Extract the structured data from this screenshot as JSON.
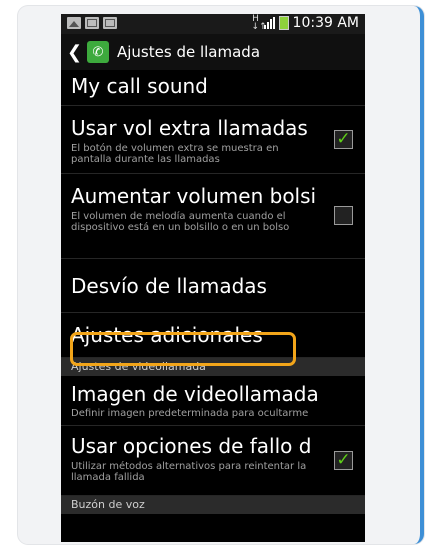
{
  "status_bar": {
    "time": "10:39 AM",
    "icons": [
      "gallery-icon",
      "mail-icon",
      "mail-icon"
    ]
  },
  "app_bar": {
    "title": "Ajustes de llamada",
    "back_icon": "back-arrow-icon",
    "app_icon": "phone-icon"
  },
  "settings": {
    "my_call_sound": {
      "title": "My call sound"
    },
    "extra_volume": {
      "title": "Usar vol extra llamadas",
      "subtitle": "El botón de volumen extra se muestra en pantalla durante las llamadas",
      "checked": true
    },
    "pocket_volume": {
      "title": "Aumentar volumen bolsi",
      "subtitle": "El volumen de melodía aumenta cuando el dispositivo está en un bolsillo o en un bolso",
      "checked": false
    },
    "call_forwarding": {
      "title": "Desvío de llamadas"
    },
    "additional_settings": {
      "title": "Ajustes adicionales"
    },
    "video_call_header": "Ajustes de videollamada",
    "video_call_image": {
      "title": "Imagen de videollamada",
      "subtitle": "Definir imagen predeterminada para ocultarme"
    },
    "call_fail_options": {
      "title": "Usar opciones de fallo d",
      "subtitle": "Utilizar métodos alternativos para reintentar la llamada fallida",
      "checked": true
    },
    "voicemail_header": "Buzón de voz"
  },
  "colors": {
    "highlight": "#f2a51a",
    "check": "#5fd018",
    "frame_accent": "#3d8fd6"
  }
}
